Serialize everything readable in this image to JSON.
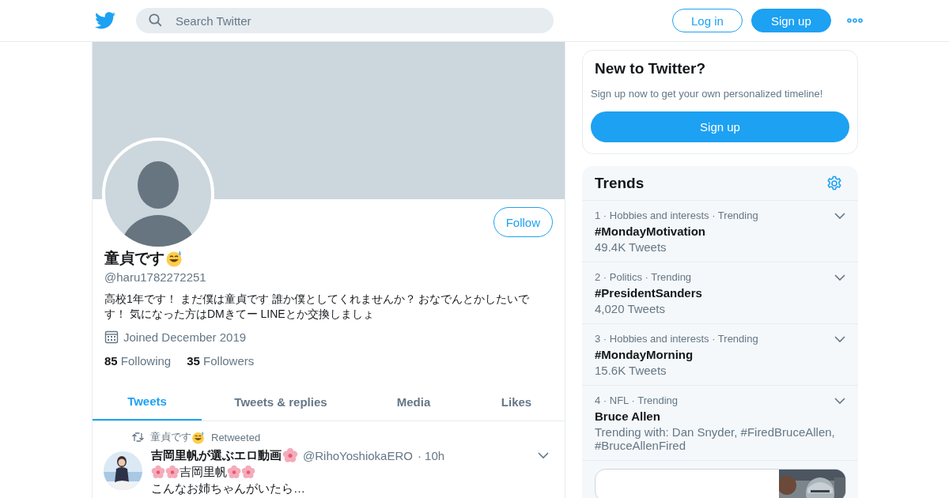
{
  "header": {
    "search": {
      "placeholder": "Search Twitter"
    },
    "buttons": [
      {
        "label": "Log in",
        "kind": "outline"
      },
      {
        "label": "Sign up",
        "kind": "filled"
      }
    ]
  },
  "profile": {
    "follow_button": "Follow",
    "name": "童貞です",
    "handle": "@haru1782272251",
    "bio": "高校1年です！ まだ僕は童貞です 誰か僕としてくれませんか？ おなでんとかしたいです！ 気になった方はDMきてー LINEとか交換しましょ",
    "joined": "Joined December 2019",
    "stats": [
      {
        "count": "85",
        "label": "Following"
      },
      {
        "count": "35",
        "label": "Followers"
      }
    ]
  },
  "tabs": [
    {
      "label": "Tweets",
      "selected": true
    },
    {
      "label": "Tweets & replies",
      "selected": false
    },
    {
      "label": "Media",
      "selected": false
    },
    {
      "label": "Likes",
      "selected": false
    }
  ],
  "tweets": [
    {
      "retweeted_by": "童貞です",
      "retweet_label": "Retweeted",
      "author": "吉岡里帆が選ぶエロ動画",
      "handle": "@RihoYoshiokaERO",
      "time": "· 10h",
      "lines": [
        "吉岡里帆",
        "こんなお姉ちゃんがいたら…"
      ]
    }
  ],
  "sidebar": {
    "signup_card": {
      "title": "New to Twitter?",
      "text": "Sign up now to get your own personalized timeline!",
      "button": "Sign up"
    },
    "trends": {
      "title": "Trends",
      "items": [
        {
          "context": "1 · Hobbies and interests · Trending",
          "name": "#MondayMotivation",
          "meta": "49.4K Tweets"
        },
        {
          "context": "2 · Politics · Trending",
          "name": "#PresidentSanders",
          "meta": "4,020 Tweets"
        },
        {
          "context": "3 · Hobbies and interests · Trending",
          "name": "#MondayMorning",
          "meta": "15.6K Tweets"
        },
        {
          "context": "4 · NFL · Trending",
          "name": "Bruce Allen",
          "meta": "Trending with: Dan Snyder, #FiredBruceAllen, #BruceAllenFired"
        }
      ]
    }
  }
}
